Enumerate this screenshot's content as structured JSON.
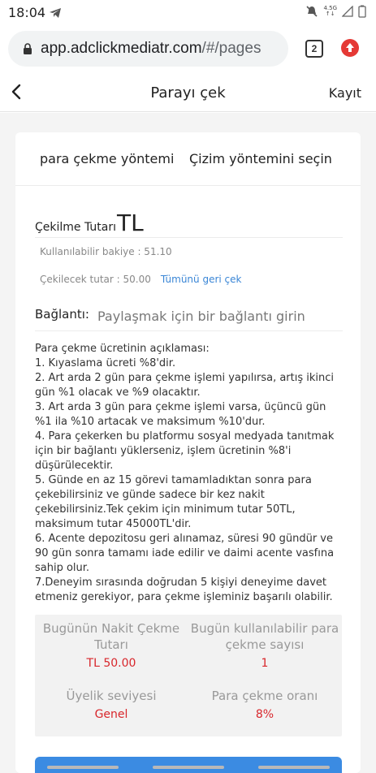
{
  "status": {
    "time": "18:04",
    "network": [
      "4.5G",
      "↑↓"
    ]
  },
  "browser": {
    "url_host": "app.adclickmediatr.com",
    "url_path": "/#/pages",
    "tab_count": "2"
  },
  "header": {
    "title": "Parayı çek",
    "record": "Kayıt"
  },
  "method": {
    "label": "para çekme yöntemi",
    "select": "Çizim yöntemini seçin"
  },
  "amount": {
    "label": "Çekilme Tutarı",
    "currency": "TL",
    "balance": "Kullanılabilir bakiye : 51.10",
    "withdraw": "Çekilecek tutar : 50.00",
    "withdraw_all": "Tümünü geri çek"
  },
  "link": {
    "label": "Bağlantı:",
    "placeholder": "Paylaşmak için bir bağlantı girin"
  },
  "rules": [
    "Para çekme ücretinin açıklaması:",
    "1. Kıyaslama ücreti %8'dir.",
    "2. Art arda 2 gün para çekme işlemi yapılırsa, artış ikinci gün %1 olacak ve %9 olacaktır.",
    "3. Art arda 3 gün para çekme işlemi varsa, üçüncü gün %1 ila %10 artacak ve maksimum %10'dur.",
    "4. Para çekerken bu platformu sosyal medyada tanıtmak için bir bağlantı yüklerseniz, işlem ücretinin %8'i düşürülecektir.",
    "5. Günde en az 15 görevi tamamladıktan sonra para çekebilirsiniz ve günde sadece bir kez nakit çekebilirsiniz.Tek çekim için minimum tutar 50TL, maksimum tutar 45000TL'dir.",
    "6. Acente depozitosu geri alınamaz, süresi 90 gündür ve 90 gün sonra tamamı iade edilir ve daimi acente vasfına sahip olur.",
    "7.Deneyim sırasında doğrudan 5 kişiyi deneyime davet etmeniz gerekiyor, para çekme işleminiz başarılı olabilir."
  ],
  "stats": {
    "today_cash_label": "Bugünün Nakit Çekme Tutarı",
    "today_cash_value": "TL 50.00",
    "available_count_label": "Bugün kullanılabilir para çekme sayısı",
    "available_count_value": "1",
    "member_level_label": "Üyelik seviyesi",
    "member_level_value": "Genel",
    "rate_label": "Para çekme oranı",
    "rate_value": "8%"
  },
  "colors": {
    "accent_red": "#d8262b",
    "link_blue": "#3a86d6",
    "button_blue": "#3b8be2"
  }
}
